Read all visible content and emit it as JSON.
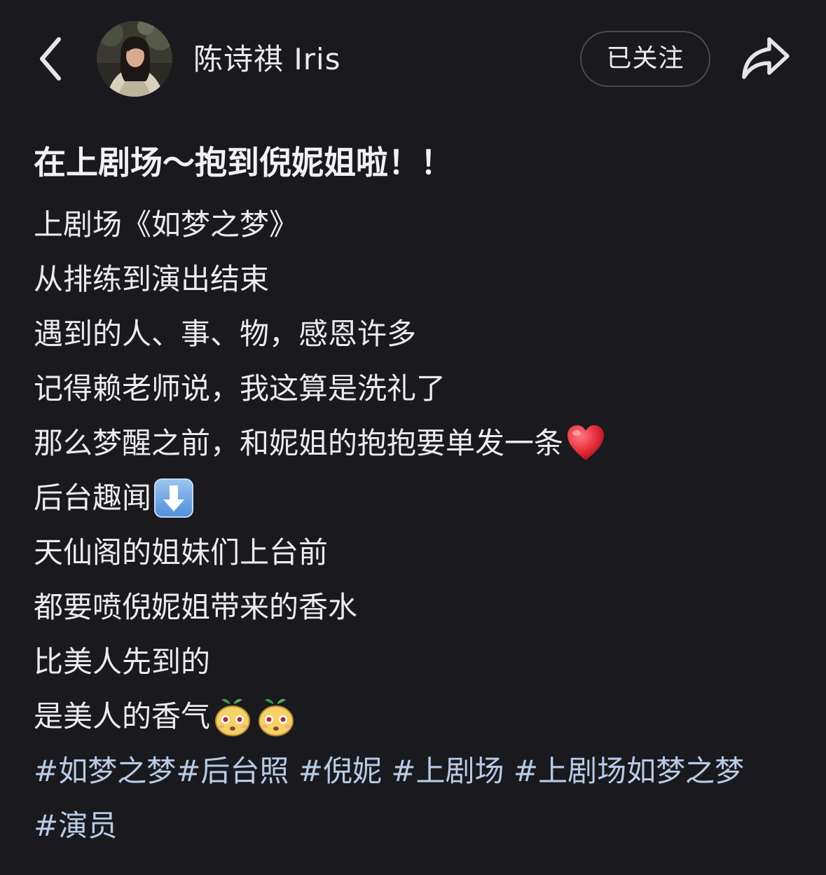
{
  "header": {
    "back_icon": "chevron-left-icon",
    "username": "陈诗祺 Iris",
    "follow_label": "已关注",
    "share_icon": "share-arrow-icon"
  },
  "post": {
    "title": "在上剧场～抱到倪妮姐啦！！",
    "lines": [
      {
        "text": "上剧场《如梦之梦》"
      },
      {
        "text": "从排练到演出结束"
      },
      {
        "text": "遇到的人、事、物，感恩许多"
      },
      {
        "text": "记得赖老师说，我这算是洗礼了"
      },
      {
        "text": "那么梦醒之前，和妮姐的抱抱要单发一条",
        "emoji": "red-heart-emoji"
      },
      {
        "text": "后台趣闻",
        "emoji": "down-arrow-emoji"
      },
      {
        "text": "天仙阁的姐妹们上台前"
      },
      {
        "text": "都要喷倪妮姐带来的香水"
      },
      {
        "text": "比美人先到的"
      },
      {
        "text": "是美人的香气",
        "emoji": "sprout-face-emoji x2"
      }
    ],
    "tags": [
      "#如梦之梦",
      "#后台照",
      "#倪妮",
      "#上剧场",
      "#上剧场如梦之梦",
      "#演员"
    ]
  },
  "colors": {
    "background": "#19191e",
    "text": "#ececef",
    "tag": "#b8cbe6",
    "follow_border": "#4a4a52",
    "heart": "#e8323f"
  }
}
